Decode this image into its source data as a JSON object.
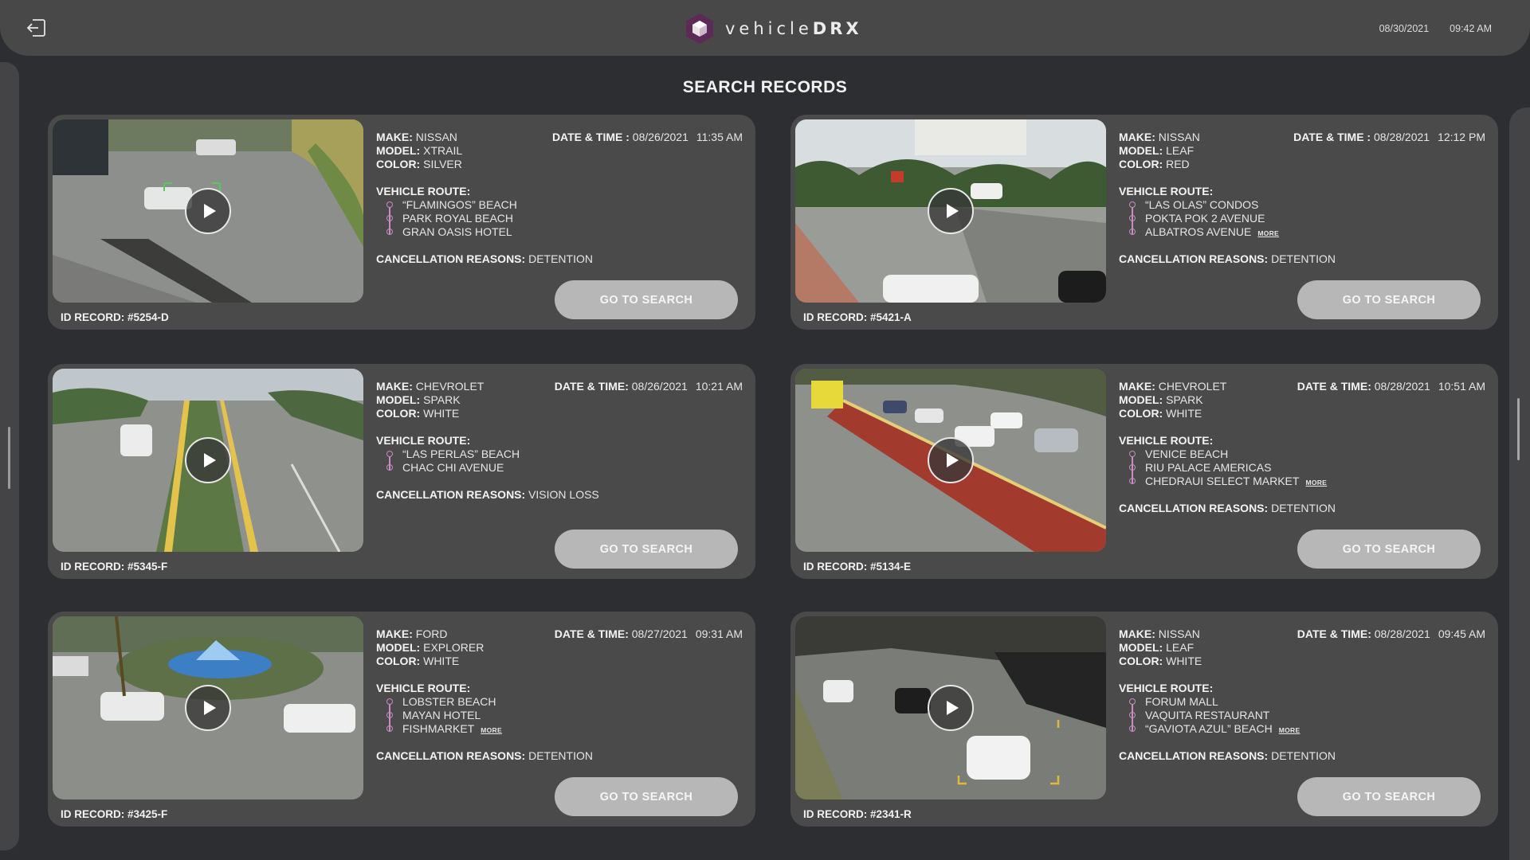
{
  "header": {
    "brand_light": "vehicle",
    "brand_bold": "DRX",
    "date": "08/30/2021",
    "time": "09:42 AM",
    "back_icon": "logout-arrow-icon"
  },
  "page_title": "SEARCH RECORDS",
  "labels": {
    "make": "MAKE:",
    "model": "MODEL:",
    "color": "COLOR:",
    "route": "VEHICLE ROUTE:",
    "cancel": "CANCELLATION REASONS:",
    "more": "MORE",
    "button": "GO TO SEARCH"
  },
  "records": [
    {
      "id": "ID RECORD: #5254-D",
      "make": "NISSAN",
      "model": "XTRAIL",
      "color": "SILVER",
      "datetime_label": "DATE & TIME :",
      "date": "08/26/2021",
      "time": "11:35 AM",
      "route": [
        "“FLAMINGOS” BEACH",
        "PARK ROYAL BEACH",
        "GRAN OASIS HOTEL"
      ],
      "more": false,
      "cancellation": "DETENTION"
    },
    {
      "id": "ID RECORD: #5421-A",
      "make": "NISSAN",
      "model": "LEAF",
      "color": "RED",
      "datetime_label": "DATE & TIME :",
      "date": "08/28/2021",
      "time": "12:12 PM",
      "route": [
        "“LAS OLAS” CONDOS",
        "POKTA POK 2 AVENUE",
        "ALBATROS AVENUE"
      ],
      "more": true,
      "cancellation": "DETENTION"
    },
    {
      "id": "ID RECORD: #5345-F",
      "make": "CHEVROLET",
      "model": "SPARK",
      "color": "WHITE",
      "datetime_label": "DATE & TIME:",
      "date": "08/26/2021",
      "time": "10:21 AM",
      "route": [
        "“LAS PERLAS” BEACH",
        "CHAC CHI AVENUE"
      ],
      "more": false,
      "cancellation": "VISION LOSS"
    },
    {
      "id": "ID RECORD: #5134-E",
      "make": "CHEVROLET",
      "model": "SPARK",
      "color": "WHITE",
      "datetime_label": "DATE & TIME:",
      "date": "08/28/2021",
      "time": "10:51 AM",
      "route": [
        "VENICE BEACH",
        "RIU PALACE AMERICAS",
        "CHEDRAUI SELECT MARKET"
      ],
      "more": true,
      "cancellation": "DETENTION"
    },
    {
      "id": "ID RECORD: #3425-F",
      "make": "FORD",
      "model": "EXPLORER",
      "color": "WHITE",
      "datetime_label": "DATE & TIME:",
      "date": "08/27/2021",
      "time": "09:31 AM",
      "route": [
        "LOBSTER BEACH",
        "MAYAN HOTEL",
        "FISHMARKET"
      ],
      "more": true,
      "cancellation": "DETENTION"
    },
    {
      "id": "ID RECORD: #2341-R",
      "make": "NISSAN",
      "model": "LEAF",
      "color": "WHITE",
      "datetime_label": "DATE & TIME:",
      "date": "08/28/2021",
      "time": "09:45 AM",
      "route": [
        "FORUM MALL",
        "VAQUITA RESTAURANT",
        "“GAVIOTA AZUL” BEACH"
      ],
      "more": true,
      "cancellation": "DETENTION"
    }
  ]
}
